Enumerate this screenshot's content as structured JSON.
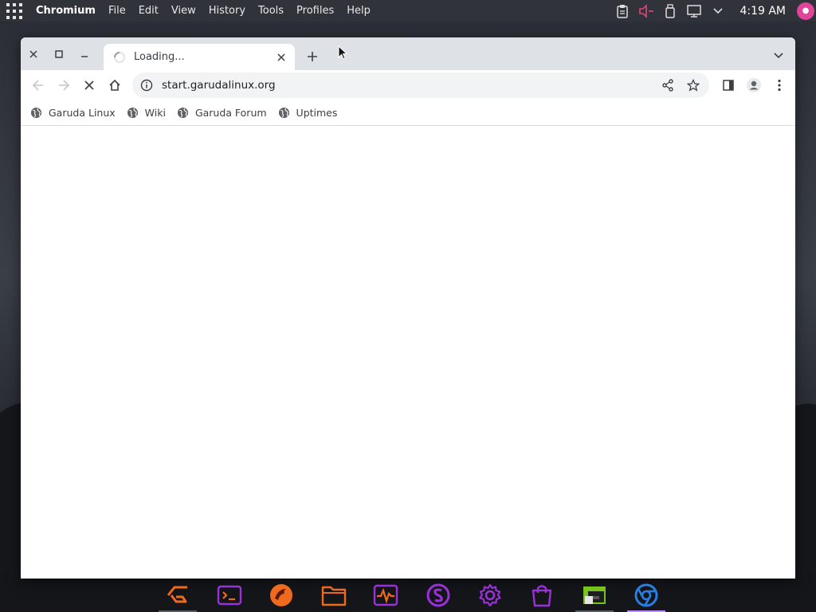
{
  "top_panel": {
    "app_name": "Chromium",
    "menus": [
      "File",
      "Edit",
      "View",
      "History",
      "Tools",
      "Profiles",
      "Help"
    ],
    "clock": "4:19 AM",
    "tray_icons": [
      "clipboard-icon",
      "volume-muted-icon",
      "usb-drive-icon",
      "network-icon",
      "chevron-down-icon"
    ]
  },
  "browser": {
    "tab": {
      "title": "Loading...",
      "loading": true
    },
    "address": {
      "url": "start.garudalinux.org"
    },
    "bookmarks": [
      {
        "label": "Garuda Linux"
      },
      {
        "label": "Wiki"
      },
      {
        "label": "Garuda Forum"
      },
      {
        "label": "Uptimes"
      }
    ]
  },
  "dock": {
    "items": [
      "garuda-welcome-icon",
      "terminal-icon",
      "garuda-eagle-icon",
      "file-manager-icon",
      "system-monitor-icon",
      "garuda-settings-icon",
      "settings-gear-icon",
      "software-store-icon",
      "garuda-gamer-icon",
      "chromium-icon"
    ],
    "active": "chromium-icon"
  },
  "colors": {
    "accent_pink": "#e0459a",
    "dock_orange": "#f06a1d",
    "dock_purple": "#9a30d8",
    "active_indicator": "#b98bff"
  }
}
